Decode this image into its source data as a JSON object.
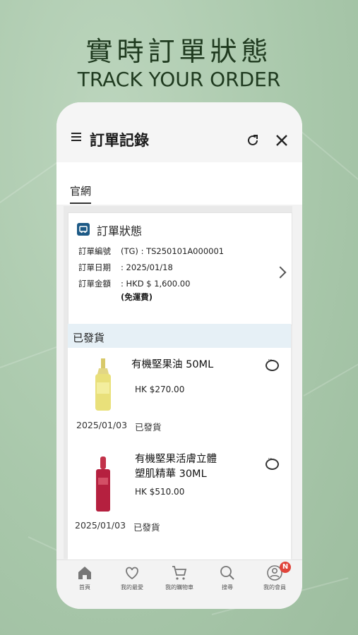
{
  "hero": {
    "title": "實時訂單狀態",
    "subtitle": "TRACK YOUR ORDER"
  },
  "header": {
    "title": "訂單記錄"
  },
  "tabs": [
    {
      "label": "官網"
    }
  ],
  "order": {
    "status_title": "訂單狀態",
    "number_label": "訂單編號",
    "number_value": "(TG) : TS250101A000001",
    "date_label": "訂單日期",
    "date_value": ": 2025/01/18",
    "amount_label": "訂單金額",
    "amount_value": ": HKD $ 1,600.00",
    "shipping_note": "(免運費)"
  },
  "shipment_section": {
    "label": "已發貨"
  },
  "items": [
    {
      "name": "有機堅果油 50ML",
      "price": "HK $270.00",
      "date": "2025/01/03",
      "status": "已發貨"
    },
    {
      "name_line1": "有機堅果活膚立體",
      "name_line2": "塑肌精華 30ML",
      "price": "HK $510.00",
      "date": "2025/01/03",
      "status": "已發貨"
    }
  ],
  "bottom_nav": [
    {
      "label": "首頁",
      "icon": "home-icon"
    },
    {
      "label": "我的最愛",
      "icon": "heart-icon"
    },
    {
      "label": "我的購物車",
      "icon": "cart-icon"
    },
    {
      "label": "搜尋",
      "icon": "search-icon"
    },
    {
      "label": "我的會員",
      "icon": "user-icon",
      "badge": "N"
    }
  ],
  "colors": {
    "background": "#a9c8ab",
    "title_text": "#1f3a1f",
    "badge": "#e0443a",
    "status_icon": "#1d5a86"
  }
}
